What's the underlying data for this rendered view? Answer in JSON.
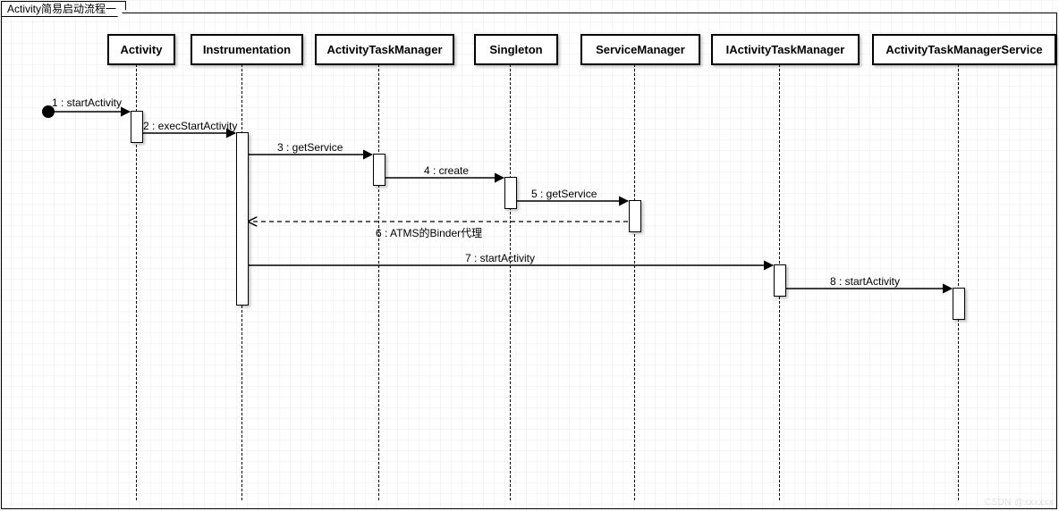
{
  "title": "Activity简易启动流程一",
  "participants": {
    "p1": "Activity",
    "p2": "Instrumentation",
    "p3": "ActivityTaskManager",
    "p4": "Singleton",
    "p5": "ServiceManager",
    "p6": "IActivityTaskManager",
    "p7": "ActivityTaskManagerService"
  },
  "messages": {
    "m1": "1 : startActivity",
    "m2": "2 : execStartActivity",
    "m3": "3 : getService",
    "m4": "4 : create",
    "m5": "5 : getService",
    "m6": "6 : ATMS的Binder代理",
    "m7": "7 : startActivity",
    "m8": "8 : startActivity"
  },
  "watermark": "CSDN @xxxxxx"
}
